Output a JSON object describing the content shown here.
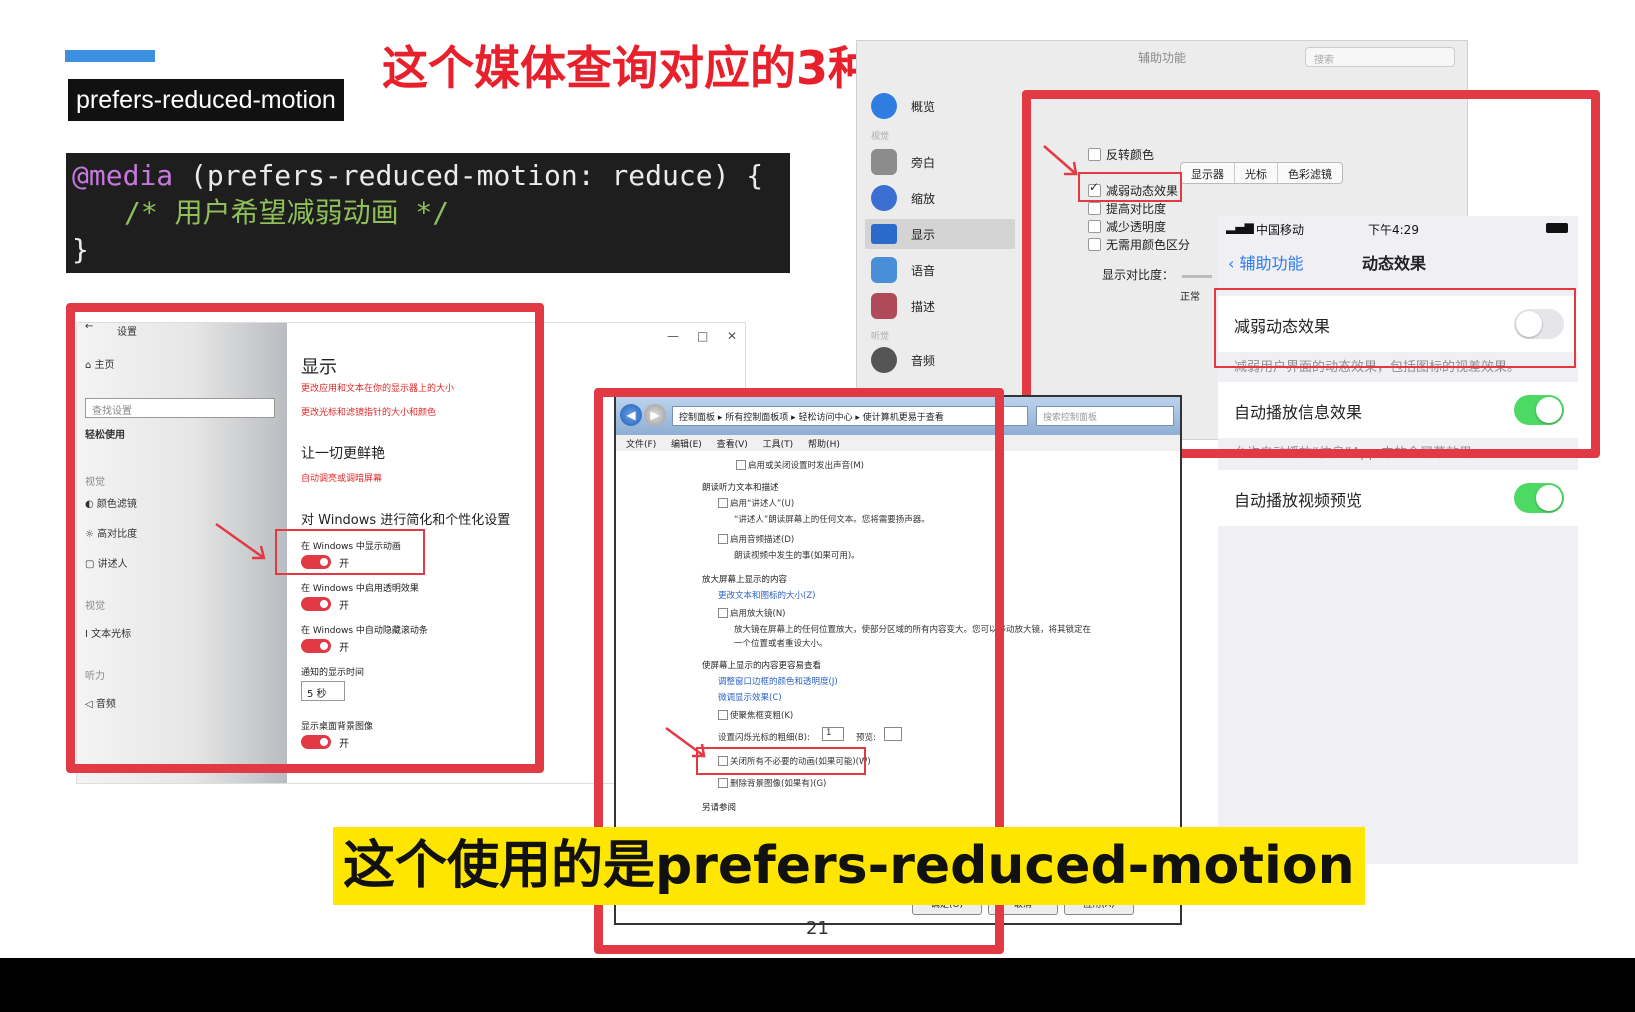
{
  "slide": {
    "heading_tag": "prefers-reduced-motion",
    "headline": "这个媒体查询对应的3种设置",
    "subtitle": "这个使用的是prefers-reduced-motion",
    "page_number": "21"
  },
  "code": {
    "line1_kw": "@media",
    "line1_rest": " (prefers-reduced-motion: reduce) {",
    "line2": "/* 用户希望减弱动画 */",
    "line3": "}"
  },
  "win10": {
    "back": "←",
    "title": "设置",
    "home": "主页",
    "search_placeholder": "查找设置",
    "group_title": "轻松使用",
    "sec_vision": "视觉",
    "item_color_filter": "颜色滤镜",
    "item_high_contrast": "高对比度",
    "item_narrator": "讲述人",
    "sec_hearing": "视觉",
    "item_text_cursor": "文本光标",
    "sec_audio": "听力",
    "item_audio": "音频",
    "page_title": "显示",
    "link1": "更改应用和文本在你的显示器上的大小",
    "link2": "更改光标和滤镜指针的大小和颜色",
    "section2": "让一切更鲜艳",
    "link3": "自动调亮或调暗屏幕",
    "section3": "对 Windows 进行简化和个性化设置",
    "opt1": "在 Windows 中显示动画",
    "opt2": "在 Windows 中启用透明效果",
    "opt3": "在 Windows 中自动隐藏滚动条",
    "toggle_on": "开",
    "notify_label": "通知的显示时间",
    "notify_value": "5 秒",
    "more_label": "显示桌面背景图像",
    "minimize": "—",
    "maximize": "□",
    "close": "✕"
  },
  "mac": {
    "window_title": "辅助功能",
    "search_placeholder": "搜索",
    "item_overview": "概览",
    "sec_vision": "视觉",
    "item_voiceover": "旁白",
    "item_zoom": "缩放",
    "item_display": "显示",
    "item_speech": "语音",
    "item_descriptions": "描述",
    "sec_hearing": "听觉",
    "item_audio": "音频",
    "tab_display": "显示器",
    "tab_cursor": "光标",
    "tab_color_filter": "色彩滤镜",
    "opt_invert": "反转颜色",
    "opt_reduce_motion": "减弱动态效果",
    "opt_increase_contrast": "提高对比度",
    "opt_reduce_transparency": "减少透明度",
    "opt_differentiate": "无需用颜色区分",
    "contrast_label": "显示对比度：",
    "contrast_normal": "正常"
  },
  "ios": {
    "carrier": "中国移动",
    "time": "下午4:29",
    "back_label": "辅助功能",
    "nav_title": "动态效果",
    "row1": "减弱动态效果",
    "row1_note": "减弱用户界面的动态效果，包括图标的视差效果。",
    "row2": "自动播放信息效果",
    "row2_note": "允许自动播放“信息”App 中的全屏幕效果。",
    "row3": "自动播放视频预览"
  },
  "win7": {
    "address": "控制面板 ▸ 所有控制面板项 ▸ 轻松访问中心 ▸ 使计算机更易于查看",
    "search_placeholder": "搜索控制面板",
    "menu": "文件(F) 编辑(E) 查看(V) 工具(T) 帮助(H)",
    "l1": "启用或关闭设置时发出声音(M)",
    "h1": "朗读听力文本和描述",
    "l2": "启用“讲述人”(U)",
    "l3": "“讲述人”朗读屏幕上的任何文本。您将需要扬声器。",
    "l4": "启用音频描述(D)",
    "l5": "朗读视频中发生的事(如果可用)。",
    "h2": "放大屏幕上显示的内容",
    "l6": "更改文本和图标的大小(Z)",
    "l7": "启用放大镜(N)",
    "l8": "放大镜在屏幕上的任何位置放大，使部分区域的所有内容变大。您可以移动放大镜，将其锁定在",
    "l9": "一个位置或者重设大小。",
    "h3": "使屏幕上显示的内容更容易查看",
    "l10": "调整窗口边框的颜色和透明度(J)",
    "l11": "微调显示效果(C)",
    "l12": "使聚焦框变粗(K)",
    "l13": "设置闪烁光标的粗细(B):",
    "l13_value": "1",
    "l13_preview": "预览:",
    "l14": "关闭所有不必要的动画(如果可能)(W)",
    "l15": "删除背景图像(如果有)(G)",
    "h4": "另请参阅",
    "btn_ok": "确定(O)",
    "btn_cancel": "取消",
    "btn_apply": "应用(A)"
  },
  "colors": {
    "accent_red": "#e23a45",
    "headline_red": "#e8202c",
    "subtitle_bg": "#ffe600",
    "ios_green": "#4cd964",
    "code_bg": "#1e1e1e"
  }
}
